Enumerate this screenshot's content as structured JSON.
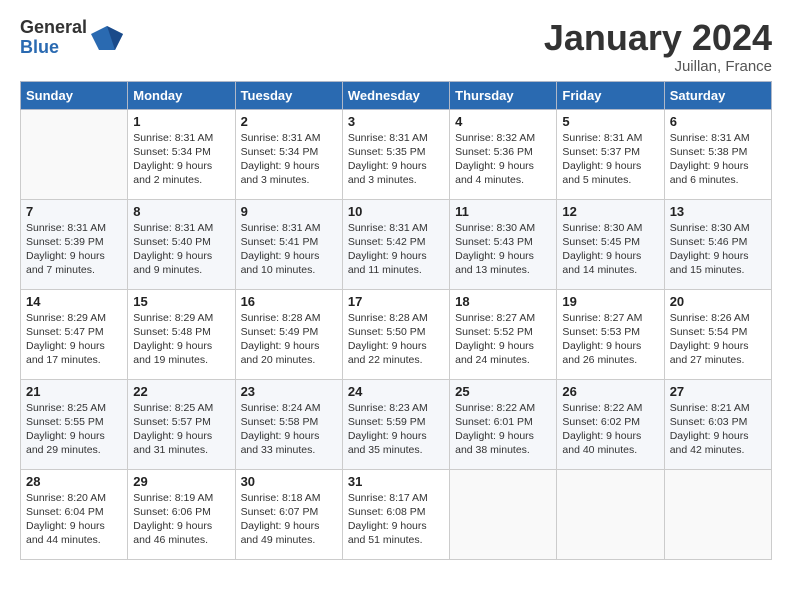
{
  "logo": {
    "general": "General",
    "blue": "Blue"
  },
  "title": "January 2024",
  "subtitle": "Juillan, France",
  "headers": [
    "Sunday",
    "Monday",
    "Tuesday",
    "Wednesday",
    "Thursday",
    "Friday",
    "Saturday"
  ],
  "weeks": [
    [
      {
        "day": "",
        "info": ""
      },
      {
        "day": "1",
        "info": "Sunrise: 8:31 AM\nSunset: 5:34 PM\nDaylight: 9 hours\nand 2 minutes."
      },
      {
        "day": "2",
        "info": "Sunrise: 8:31 AM\nSunset: 5:34 PM\nDaylight: 9 hours\nand 3 minutes."
      },
      {
        "day": "3",
        "info": "Sunrise: 8:31 AM\nSunset: 5:35 PM\nDaylight: 9 hours\nand 3 minutes."
      },
      {
        "day": "4",
        "info": "Sunrise: 8:32 AM\nSunset: 5:36 PM\nDaylight: 9 hours\nand 4 minutes."
      },
      {
        "day": "5",
        "info": "Sunrise: 8:31 AM\nSunset: 5:37 PM\nDaylight: 9 hours\nand 5 minutes."
      },
      {
        "day": "6",
        "info": "Sunrise: 8:31 AM\nSunset: 5:38 PM\nDaylight: 9 hours\nand 6 minutes."
      }
    ],
    [
      {
        "day": "7",
        "info": "Sunrise: 8:31 AM\nSunset: 5:39 PM\nDaylight: 9 hours\nand 7 minutes."
      },
      {
        "day": "8",
        "info": "Sunrise: 8:31 AM\nSunset: 5:40 PM\nDaylight: 9 hours\nand 9 minutes."
      },
      {
        "day": "9",
        "info": "Sunrise: 8:31 AM\nSunset: 5:41 PM\nDaylight: 9 hours\nand 10 minutes."
      },
      {
        "day": "10",
        "info": "Sunrise: 8:31 AM\nSunset: 5:42 PM\nDaylight: 9 hours\nand 11 minutes."
      },
      {
        "day": "11",
        "info": "Sunrise: 8:30 AM\nSunset: 5:43 PM\nDaylight: 9 hours\nand 13 minutes."
      },
      {
        "day": "12",
        "info": "Sunrise: 8:30 AM\nSunset: 5:45 PM\nDaylight: 9 hours\nand 14 minutes."
      },
      {
        "day": "13",
        "info": "Sunrise: 8:30 AM\nSunset: 5:46 PM\nDaylight: 9 hours\nand 15 minutes."
      }
    ],
    [
      {
        "day": "14",
        "info": "Sunrise: 8:29 AM\nSunset: 5:47 PM\nDaylight: 9 hours\nand 17 minutes."
      },
      {
        "day": "15",
        "info": "Sunrise: 8:29 AM\nSunset: 5:48 PM\nDaylight: 9 hours\nand 19 minutes."
      },
      {
        "day": "16",
        "info": "Sunrise: 8:28 AM\nSunset: 5:49 PM\nDaylight: 9 hours\nand 20 minutes."
      },
      {
        "day": "17",
        "info": "Sunrise: 8:28 AM\nSunset: 5:50 PM\nDaylight: 9 hours\nand 22 minutes."
      },
      {
        "day": "18",
        "info": "Sunrise: 8:27 AM\nSunset: 5:52 PM\nDaylight: 9 hours\nand 24 minutes."
      },
      {
        "day": "19",
        "info": "Sunrise: 8:27 AM\nSunset: 5:53 PM\nDaylight: 9 hours\nand 26 minutes."
      },
      {
        "day": "20",
        "info": "Sunrise: 8:26 AM\nSunset: 5:54 PM\nDaylight: 9 hours\nand 27 minutes."
      }
    ],
    [
      {
        "day": "21",
        "info": "Sunrise: 8:25 AM\nSunset: 5:55 PM\nDaylight: 9 hours\nand 29 minutes."
      },
      {
        "day": "22",
        "info": "Sunrise: 8:25 AM\nSunset: 5:57 PM\nDaylight: 9 hours\nand 31 minutes."
      },
      {
        "day": "23",
        "info": "Sunrise: 8:24 AM\nSunset: 5:58 PM\nDaylight: 9 hours\nand 33 minutes."
      },
      {
        "day": "24",
        "info": "Sunrise: 8:23 AM\nSunset: 5:59 PM\nDaylight: 9 hours\nand 35 minutes."
      },
      {
        "day": "25",
        "info": "Sunrise: 8:22 AM\nSunset: 6:01 PM\nDaylight: 9 hours\nand 38 minutes."
      },
      {
        "day": "26",
        "info": "Sunrise: 8:22 AM\nSunset: 6:02 PM\nDaylight: 9 hours\nand 40 minutes."
      },
      {
        "day": "27",
        "info": "Sunrise: 8:21 AM\nSunset: 6:03 PM\nDaylight: 9 hours\nand 42 minutes."
      }
    ],
    [
      {
        "day": "28",
        "info": "Sunrise: 8:20 AM\nSunset: 6:04 PM\nDaylight: 9 hours\nand 44 minutes."
      },
      {
        "day": "29",
        "info": "Sunrise: 8:19 AM\nSunset: 6:06 PM\nDaylight: 9 hours\nand 46 minutes."
      },
      {
        "day": "30",
        "info": "Sunrise: 8:18 AM\nSunset: 6:07 PM\nDaylight: 9 hours\nand 49 minutes."
      },
      {
        "day": "31",
        "info": "Sunrise: 8:17 AM\nSunset: 6:08 PM\nDaylight: 9 hours\nand 51 minutes."
      },
      {
        "day": "",
        "info": ""
      },
      {
        "day": "",
        "info": ""
      },
      {
        "day": "",
        "info": ""
      }
    ]
  ]
}
